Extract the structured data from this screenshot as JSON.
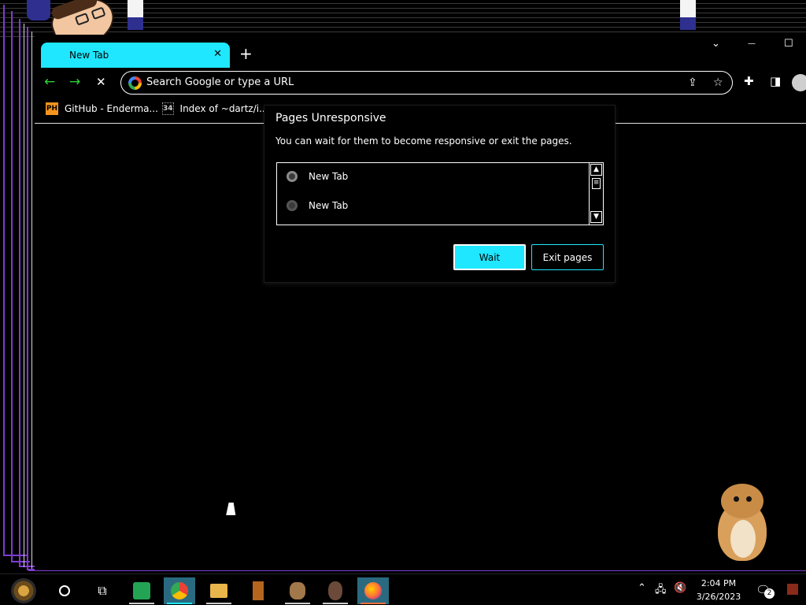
{
  "browser": {
    "tab": {
      "title": "New Tab",
      "close_glyph": "✕"
    },
    "new_tab_glyph": "+",
    "window_controls": {
      "chevron": "⌄",
      "minimize": "—",
      "maximize": "☐"
    },
    "nav": {
      "back": "←",
      "forward": "→",
      "stop": "✕"
    },
    "omnibox": {
      "placeholder": "Search Google or type a URL"
    },
    "bookmarks": [
      {
        "icon": "PH",
        "label": "GitHub - Enderma..."
      },
      {
        "icon": "34",
        "label": "Index of ~dartz/i..."
      }
    ]
  },
  "dialog": {
    "title": "Pages Unresponsive",
    "message": "You can wait for them to become responsive or exit the pages.",
    "pages": [
      "New Tab",
      "New Tab"
    ],
    "wait_label": "Wait",
    "exit_label": "Exit pages"
  },
  "taskbar": {
    "time": "2:04 PM",
    "date": "3/26/2023",
    "notification_count": "2"
  },
  "colors": {
    "accent": "#1ee7ff",
    "frame": "#7d3ccf",
    "background": "#000000"
  }
}
